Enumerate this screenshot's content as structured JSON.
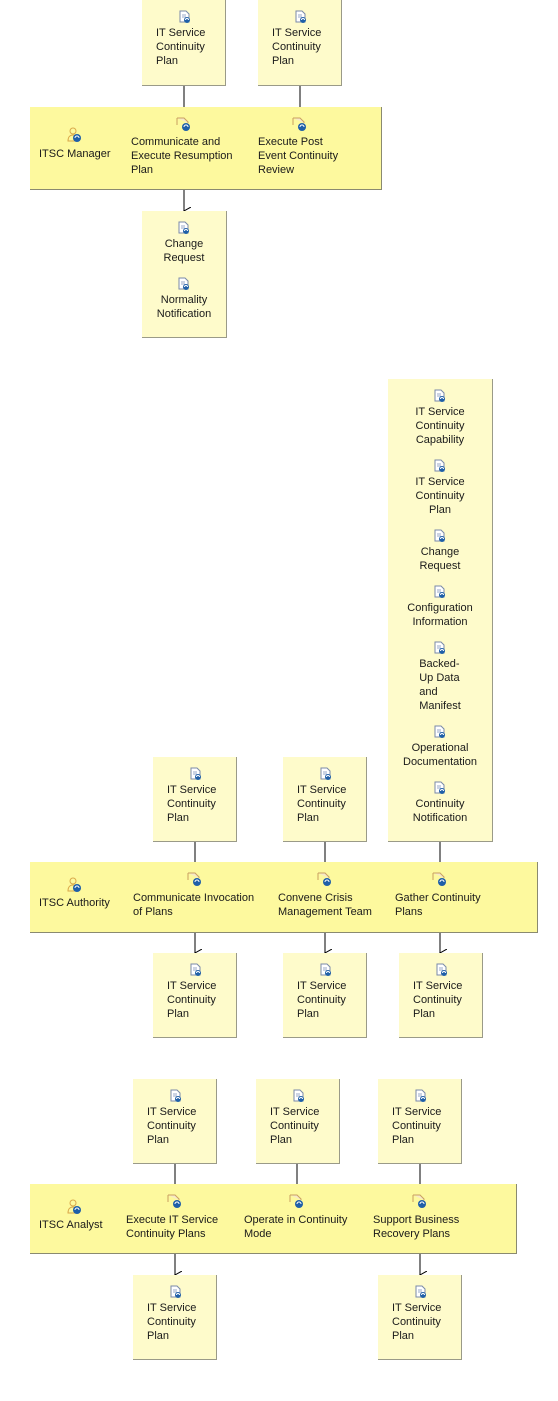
{
  "diagram": {
    "colors": {
      "lane_fill": "#fdf99e",
      "artifact_fill": "#fefbcb",
      "connector": "#000000",
      "icon_blue": "#1f5fa8",
      "role_icon": "#d9a84a"
    },
    "icons": {
      "artifact": "document-sync-icon",
      "task": "task-sync-icon",
      "role": "role-person-icon"
    },
    "sections": [
      {
        "role": "ITSC Manager",
        "inputs": [
          {
            "items": [
              "IT Service\nContinuity\nPlan"
            ]
          },
          {
            "items": [
              "IT Service\nContinuity\nPlan"
            ]
          }
        ],
        "tasks": [
          "Communicate and\nExecute Resumption\nPlan",
          "Execute Post\nEvent Continuity\nReview"
        ],
        "outputs": [
          {
            "items": [
              "Change\nRequest",
              "Normality\nNotification"
            ]
          }
        ]
      },
      {
        "role": "ITSC Authority",
        "inputs": [
          {
            "items": [
              "IT Service\nContinuity\nPlan"
            ]
          },
          {
            "items": [
              "IT Service\nContinuity\nPlan"
            ]
          },
          {
            "items": [
              "IT Service\nContinuity\nCapability",
              "IT Service\nContinuity\nPlan",
              "Change\nRequest",
              "Configuration\nInformation",
              "Backed-\nUp Data\nand\nManifest",
              "Operational\nDocumentation",
              "Continuity\nNotification"
            ]
          }
        ],
        "tasks": [
          "Communicate Invocation\nof Plans",
          "Convene Crisis\nManagement Team",
          "Gather Continuity\nPlans"
        ],
        "outputs": [
          {
            "items": [
              "IT Service\nContinuity\nPlan"
            ]
          },
          {
            "items": [
              "IT Service\nContinuity\nPlan"
            ]
          },
          {
            "items": [
              "IT Service\nContinuity\nPlan"
            ]
          }
        ]
      },
      {
        "role": "ITSC Analyst",
        "inputs": [
          {
            "items": [
              "IT Service\nContinuity\nPlan"
            ]
          },
          {
            "items": [
              "IT Service\nContinuity\nPlan"
            ]
          },
          {
            "items": [
              "IT Service\nContinuity\nPlan"
            ]
          }
        ],
        "tasks": [
          "Execute IT Service\nContinuity Plans",
          "Operate in Continuity\nMode",
          "Support Business\nRecovery Plans"
        ],
        "outputs": [
          {
            "items": [
              "IT Service\nContinuity\nPlan"
            ]
          },
          {
            "items": [
              "IT Service\nContinuity\nPlan"
            ]
          }
        ]
      }
    ]
  }
}
